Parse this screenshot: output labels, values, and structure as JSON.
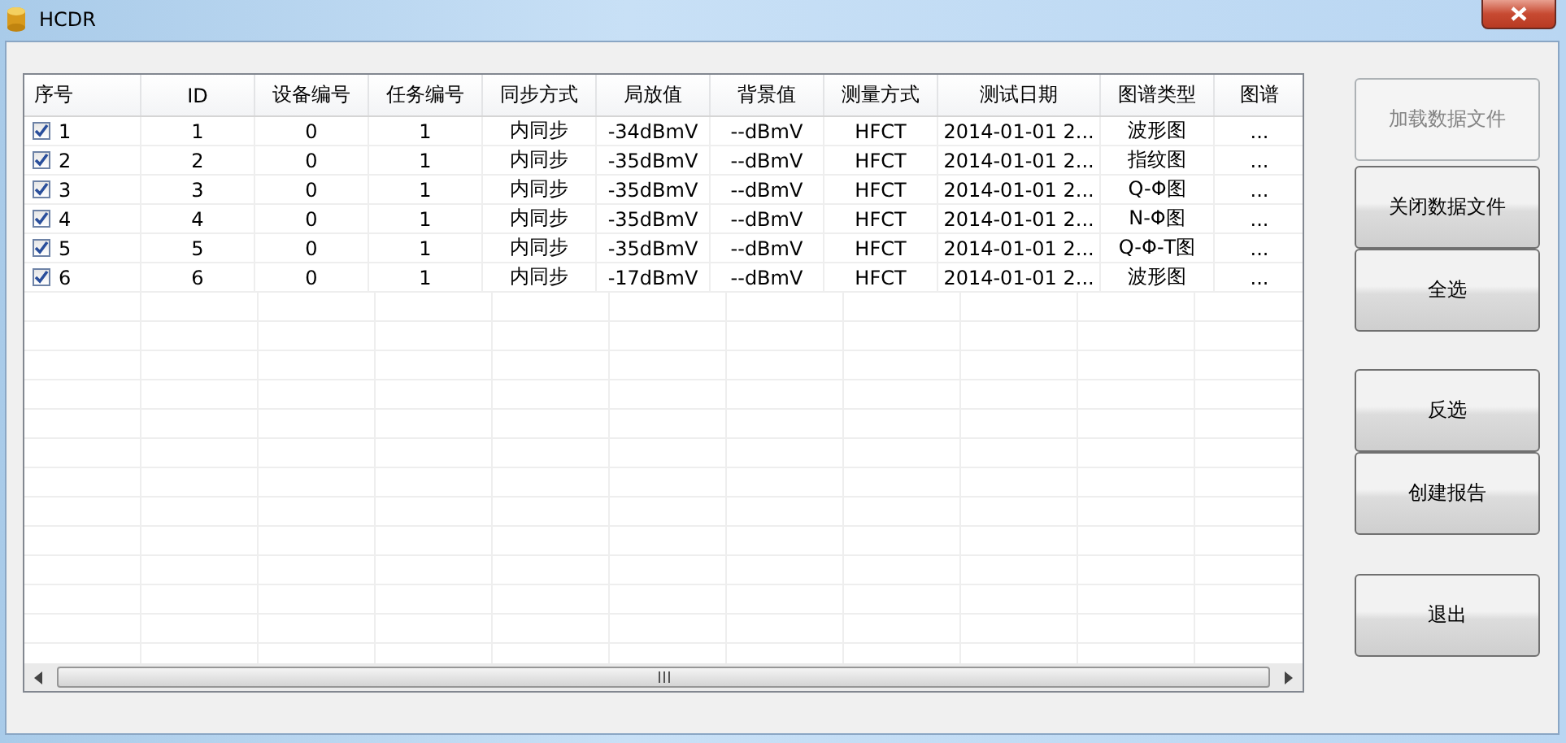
{
  "window": {
    "title": "HCDR"
  },
  "table": {
    "columns": [
      "序号",
      "ID",
      "设备编号",
      "任务编号",
      "同步方式",
      "局放值",
      "背景值",
      "测量方式",
      "测试日期",
      "图谱类型",
      "图谱"
    ],
    "rows": [
      {
        "checked": true,
        "cells": [
          "1",
          "1",
          "0",
          "1",
          "内同步",
          "-34dBmV",
          "--dBmV",
          "HFCT",
          "2014-01-01 2...",
          "波形图",
          "..."
        ]
      },
      {
        "checked": true,
        "cells": [
          "2",
          "2",
          "0",
          "1",
          "内同步",
          "-35dBmV",
          "--dBmV",
          "HFCT",
          "2014-01-01 2...",
          "指纹图",
          "..."
        ]
      },
      {
        "checked": true,
        "cells": [
          "3",
          "3",
          "0",
          "1",
          "内同步",
          "-35dBmV",
          "--dBmV",
          "HFCT",
          "2014-01-01 2...",
          "Q-Φ图",
          "..."
        ]
      },
      {
        "checked": true,
        "cells": [
          "4",
          "4",
          "0",
          "1",
          "内同步",
          "-35dBmV",
          "--dBmV",
          "HFCT",
          "2014-01-01 2...",
          "N-Φ图",
          "..."
        ]
      },
      {
        "checked": true,
        "cells": [
          "5",
          "5",
          "0",
          "1",
          "内同步",
          "-35dBmV",
          "--dBmV",
          "HFCT",
          "2014-01-01 2...",
          "Q-Φ-T图",
          "..."
        ]
      },
      {
        "checked": true,
        "cells": [
          "6",
          "6",
          "0",
          "1",
          "内同步",
          "-17dBmV",
          "--dBmV",
          "HFCT",
          "2014-01-01 2...",
          "波形图",
          "..."
        ]
      }
    ]
  },
  "buttons": [
    {
      "label": "加载数据文件",
      "disabled": true
    },
    {
      "label": "关闭数据文件",
      "disabled": false
    },
    {
      "label": "全选",
      "disabled": false
    },
    {
      "label": "反选",
      "disabled": false
    },
    {
      "label": "创建报告",
      "disabled": false
    },
    {
      "label": "退出",
      "disabled": false
    }
  ]
}
